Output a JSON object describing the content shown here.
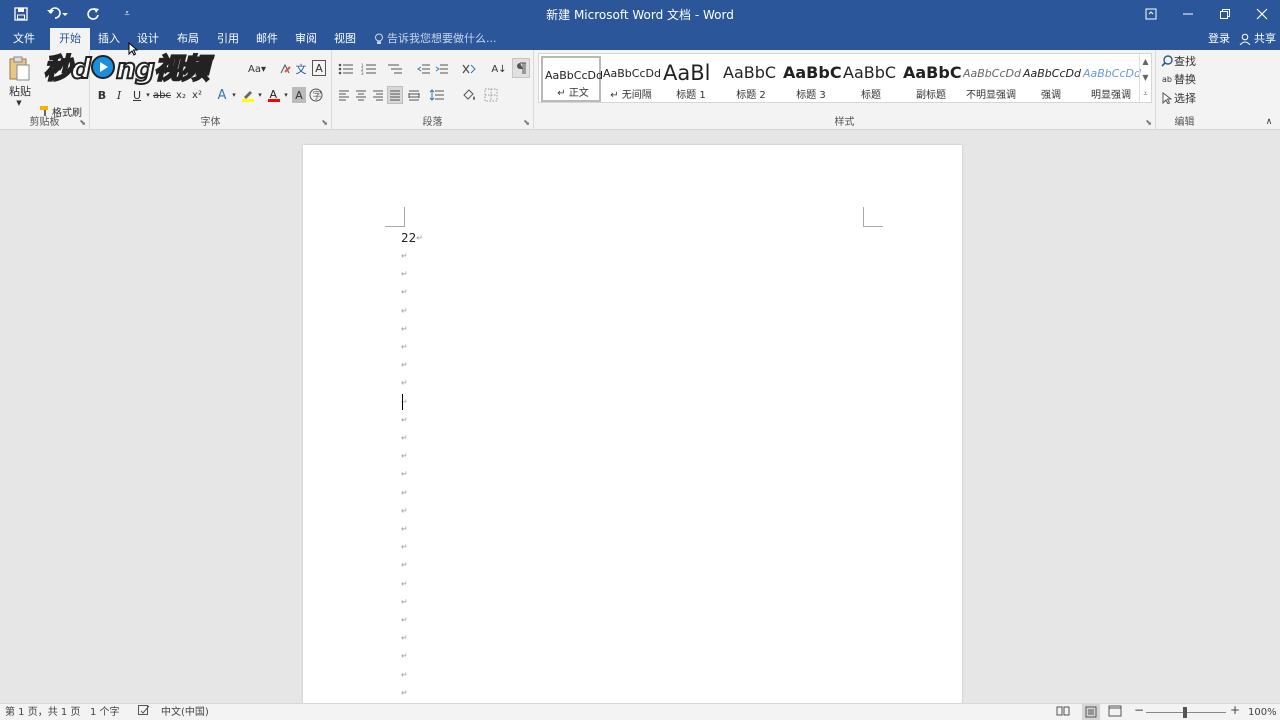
{
  "window": {
    "title": "新建 Microsoft Word 文档 - Word"
  },
  "qat": {
    "save_icon": "save-icon",
    "undo_icon": "undo-icon",
    "redo_icon": "repeat-icon",
    "customize_icon": "customize-qat-icon"
  },
  "tabs": [
    {
      "label": "文件"
    },
    {
      "label": "开始"
    },
    {
      "label": "插入"
    },
    {
      "label": "设计"
    },
    {
      "label": "布局"
    },
    {
      "label": "引用"
    },
    {
      "label": "邮件"
    },
    {
      "label": "审阅"
    },
    {
      "label": "视图"
    }
  ],
  "tellme": {
    "placeholder": "告诉我您想要做什么..."
  },
  "account": {
    "signin": "登录",
    "share": "共享"
  },
  "ribbon": {
    "clipboard": {
      "label": "剪贴板",
      "paste": "粘贴",
      "format_painter": "格式刷"
    },
    "font": {
      "label": "字体",
      "size_btn": "Aa▾"
    },
    "paragraph": {
      "label": "段落"
    },
    "styles": {
      "label": "样式",
      "items": [
        {
          "sample": "AaBbCcDd",
          "name": "↵ 正文"
        },
        {
          "sample": "AaBbCcDd",
          "name": "↵ 无间隔"
        },
        {
          "sample": "AaBl",
          "name": "标题 1"
        },
        {
          "sample": "AaBbC",
          "name": "标题 2"
        },
        {
          "sample": "AaBbC",
          "name": "标题 3"
        },
        {
          "sample": "AaBbC",
          "name": "标题"
        },
        {
          "sample": "AaBbC",
          "name": "副标题"
        },
        {
          "sample": "AaBbCcDd",
          "name": "不明显强调"
        },
        {
          "sample": "AaBbCcDd",
          "name": "强调"
        },
        {
          "sample": "AaBbCcDd",
          "name": "明显强调"
        }
      ]
    },
    "editing": {
      "label": "编辑",
      "find": "查找",
      "replace": "替换",
      "select": "选择"
    }
  },
  "document": {
    "first_line": "22",
    "paragraph_mark": "↵"
  },
  "watermark": {
    "text_left": "秒d",
    "text_right": "ng视频"
  },
  "statusbar": {
    "page": "第 1 页，共 1 页",
    "words": "1 个字",
    "language": "中文(中国)",
    "zoom": "100%"
  },
  "colors": {
    "accent": "#2b579a",
    "highlight": "#ffff00",
    "font_color": "#ff0000"
  }
}
